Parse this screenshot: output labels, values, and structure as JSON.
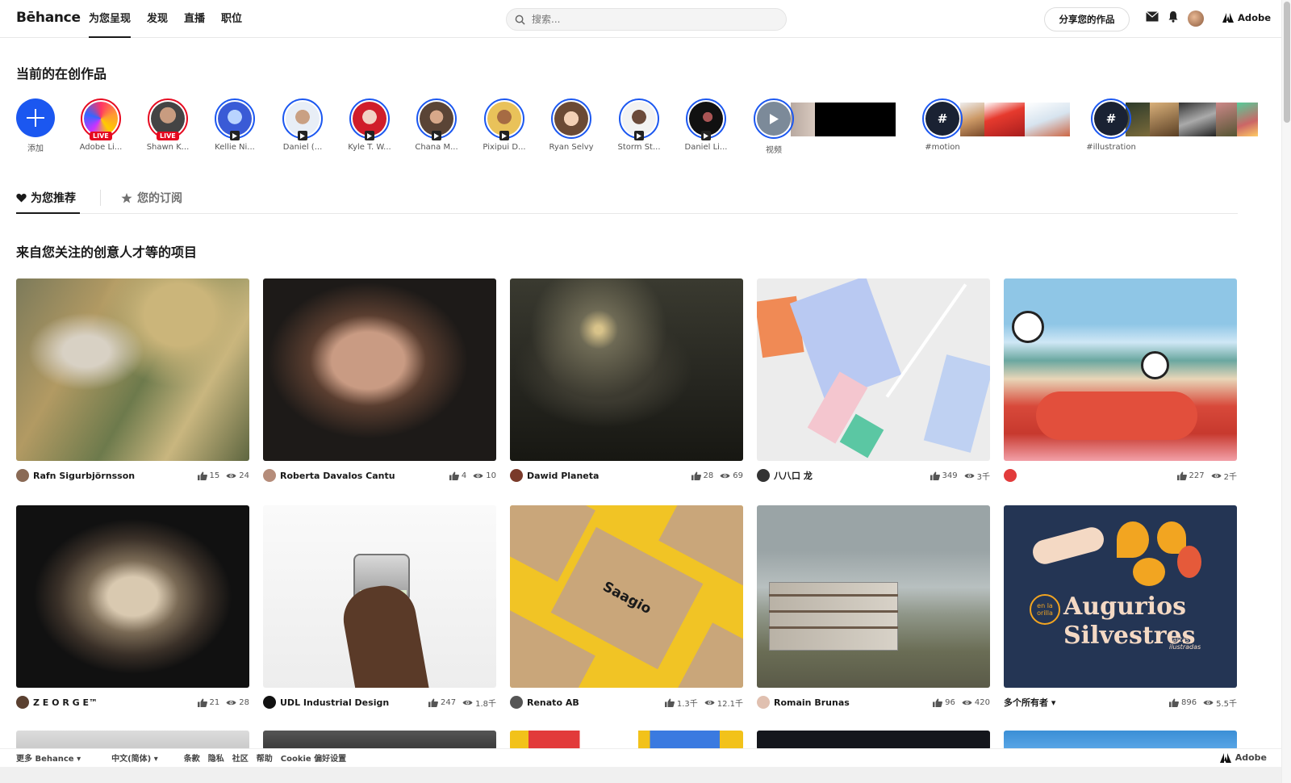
{
  "header": {
    "logo": "Bēhance",
    "nav": [
      "为您呈现",
      "发现",
      "直播",
      "职位"
    ],
    "search_placeholder": "搜索...",
    "share_label": "分享您的作品",
    "adobe_label": "Adobe"
  },
  "live": {
    "title": "当前的在创作品",
    "items": [
      {
        "label": "添加"
      },
      {
        "label": "Adobe Li...",
        "badge": "LIVE"
      },
      {
        "label": "Shawn K...",
        "badge": "LIVE"
      },
      {
        "label": "Kellie Ni..."
      },
      {
        "label": "Daniel (..."
      },
      {
        "label": "Kyle T. W..."
      },
      {
        "label": "Chana M..."
      },
      {
        "label": "Pixipui D..."
      },
      {
        "label": "Ryan Selvy"
      },
      {
        "label": "Storm St..."
      },
      {
        "label": "Daniel Li..."
      },
      {
        "label": "视频"
      },
      {
        "label": "#motion"
      },
      {
        "label": "#illustration"
      }
    ]
  },
  "tabs": {
    "recommended": "为您推荐",
    "following": "您的订阅"
  },
  "projects": {
    "title": "来自您关注的创意人才等的项目",
    "items": [
      {
        "owner": "Rafn Sigurbjörnsson",
        "likes": "15",
        "views": "24"
      },
      {
        "owner": "Roberta Davalos Cantu",
        "likes": "4",
        "views": "10"
      },
      {
        "owner": "Dawid Planeta",
        "likes": "28",
        "views": "69"
      },
      {
        "owner": "八八口 龙",
        "likes": "349",
        "views": "3千"
      },
      {
        "owner": "",
        "likes": "227",
        "views": "2千"
      },
      {
        "owner": "Z E O R G E™",
        "likes": "21",
        "views": "28"
      },
      {
        "owner": "UDL Industrial Design",
        "likes": "247",
        "views": "1.8千"
      },
      {
        "owner": "Renato AB",
        "likes": "1.3千",
        "views": "12.1千"
      },
      {
        "owner": "Romain Brunas",
        "likes": "96",
        "views": "420"
      },
      {
        "owner": "多个所有者 ▾",
        "likes": "896",
        "views": "5.5千"
      }
    ],
    "thumb_texts": {
      "saagio": "Saagio",
      "augurios_small": "en la orilla",
      "augurios": "Augurios Silvestres",
      "augurios_sub": "cartas ilustradas"
    }
  },
  "footer": {
    "more": "更多 Behance ▾",
    "language": "中文(简体) ▾",
    "links": [
      "条款",
      "隐私",
      "社区",
      "帮助",
      "Cookie 偏好设置"
    ],
    "adobe": "Adobe"
  }
}
